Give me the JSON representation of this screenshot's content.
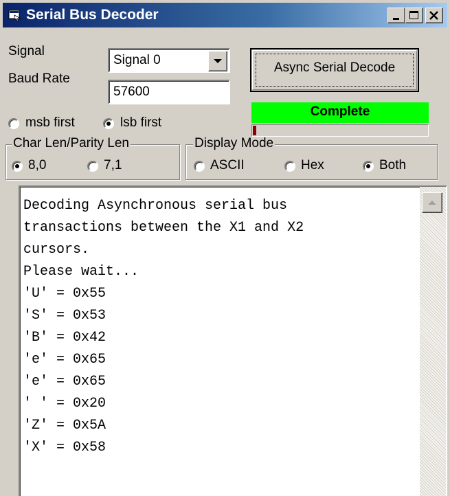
{
  "window": {
    "title": "Serial Bus Decoder",
    "controls": {
      "minimize": "_",
      "maximize": "□",
      "close": "✕"
    }
  },
  "signal": {
    "label": "Signal",
    "value": "Signal 0"
  },
  "baud": {
    "label": "Baud Rate",
    "value": "57600"
  },
  "decode_button": {
    "label": "Async Serial Decode"
  },
  "status": {
    "text": "Complete",
    "color": "#00ff00",
    "progress": 0.02
  },
  "bit_order": {
    "options": [
      {
        "label": "msb first",
        "checked": false
      },
      {
        "label": "lsb first",
        "checked": true
      }
    ]
  },
  "char_len": {
    "caption": "Char Len/Parity Len",
    "options": [
      {
        "label": "8,0",
        "checked": true
      },
      {
        "label": "7,1",
        "checked": false
      }
    ]
  },
  "display_mode": {
    "caption": "Display Mode",
    "options": [
      {
        "label": "ASCII",
        "checked": false
      },
      {
        "label": "Hex",
        "checked": false
      },
      {
        "label": "Both",
        "checked": true
      }
    ]
  },
  "output": {
    "lines": [
      "Decoding Asynchronous serial bus",
      "transactions between the X1 and X2",
      "cursors.",
      "Please wait...",
      "'U' = 0x55",
      "'S' = 0x53",
      "'B' = 0x42",
      "'e' = 0x65",
      "'e' = 0x65",
      "' ' = 0x20",
      "'Z' = 0x5A",
      "'X' = 0x58"
    ]
  },
  "icons": [
    "app-icon",
    "minimize-icon",
    "maximize-icon",
    "close-icon",
    "dropdown-arrow-icon",
    "scroll-up-arrow-icon"
  ]
}
